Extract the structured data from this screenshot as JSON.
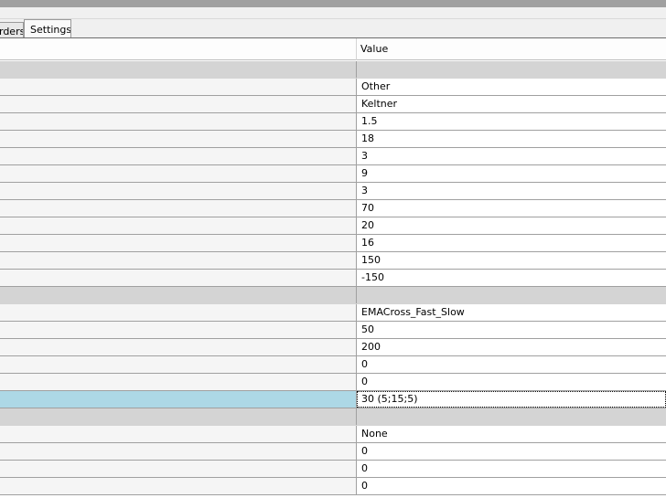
{
  "tabs": [
    {
      "label": "rders"
    },
    {
      "label": "Settings"
    }
  ],
  "grid": {
    "header_value": "Value",
    "rows": [
      {
        "type": "category",
        "value": ""
      },
      {
        "type": "prop",
        "value": "Other"
      },
      {
        "type": "prop",
        "value": "Keltner"
      },
      {
        "type": "prop",
        "value": "1.5"
      },
      {
        "type": "prop",
        "value": "18"
      },
      {
        "type": "prop",
        "value": "3"
      },
      {
        "type": "prop",
        "value": "9"
      },
      {
        "type": "prop",
        "value": "3"
      },
      {
        "type": "prop",
        "value": "70"
      },
      {
        "type": "prop",
        "value": "20"
      },
      {
        "type": "prop",
        "value": "16"
      },
      {
        "type": "prop",
        "value": "150"
      },
      {
        "type": "prop",
        "value": "-150"
      },
      {
        "type": "category",
        "value": ""
      },
      {
        "type": "prop",
        "value": "EMACross_Fast_Slow"
      },
      {
        "type": "prop",
        "value": "50"
      },
      {
        "type": "prop",
        "value": "200"
      },
      {
        "type": "prop",
        "value": "0"
      },
      {
        "type": "prop",
        "value": "0"
      },
      {
        "type": "prop",
        "value": "30 (5;15;5)",
        "selected": true
      },
      {
        "type": "category",
        "value": ""
      },
      {
        "type": "prop",
        "value": "None"
      },
      {
        "type": "prop",
        "value": "0"
      },
      {
        "type": "prop",
        "value": "0"
      },
      {
        "type": "prop",
        "value": "0"
      }
    ]
  },
  "colors": {
    "selected_row": "#add8e6",
    "category_row": "#d4d4d4",
    "grid_line": "#a0a0a0"
  }
}
